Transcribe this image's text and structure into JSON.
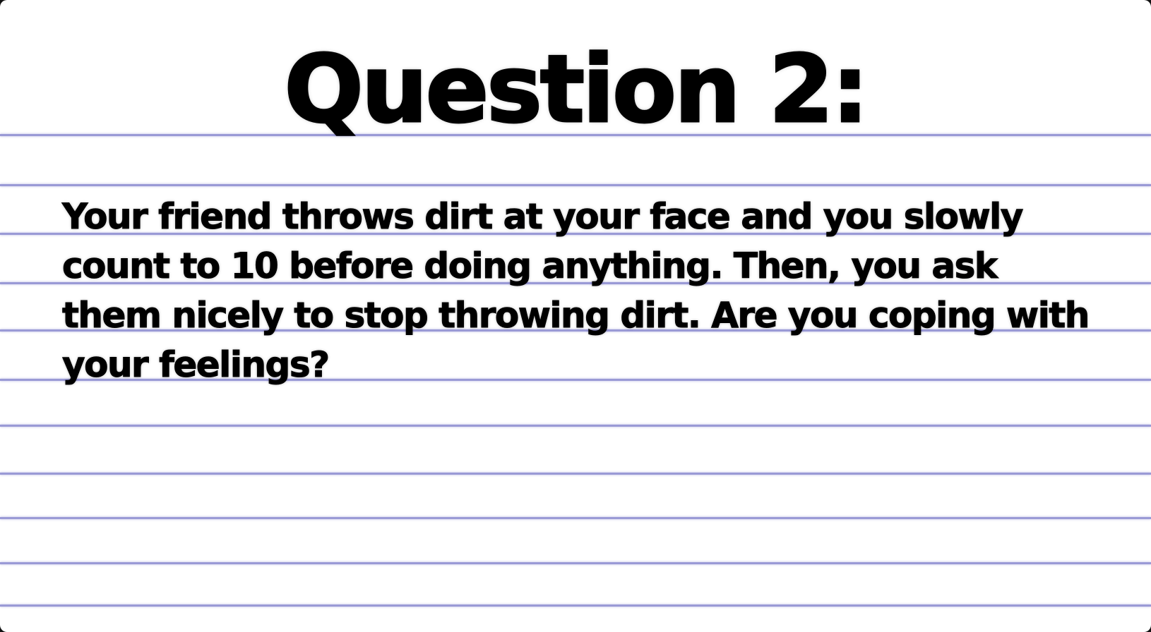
{
  "slide": {
    "title": "Question 2:",
    "question": "Your friend throws dirt at your face and you slowly count to 10 before doing anything. Then, you ask them nicely to stop throwing dirt. Are you coping with your feelings?"
  },
  "colors": {
    "page_background": "#ffffff",
    "ruled_line": "#9a9ad6",
    "text": "#000000",
    "frame": "#111111"
  }
}
